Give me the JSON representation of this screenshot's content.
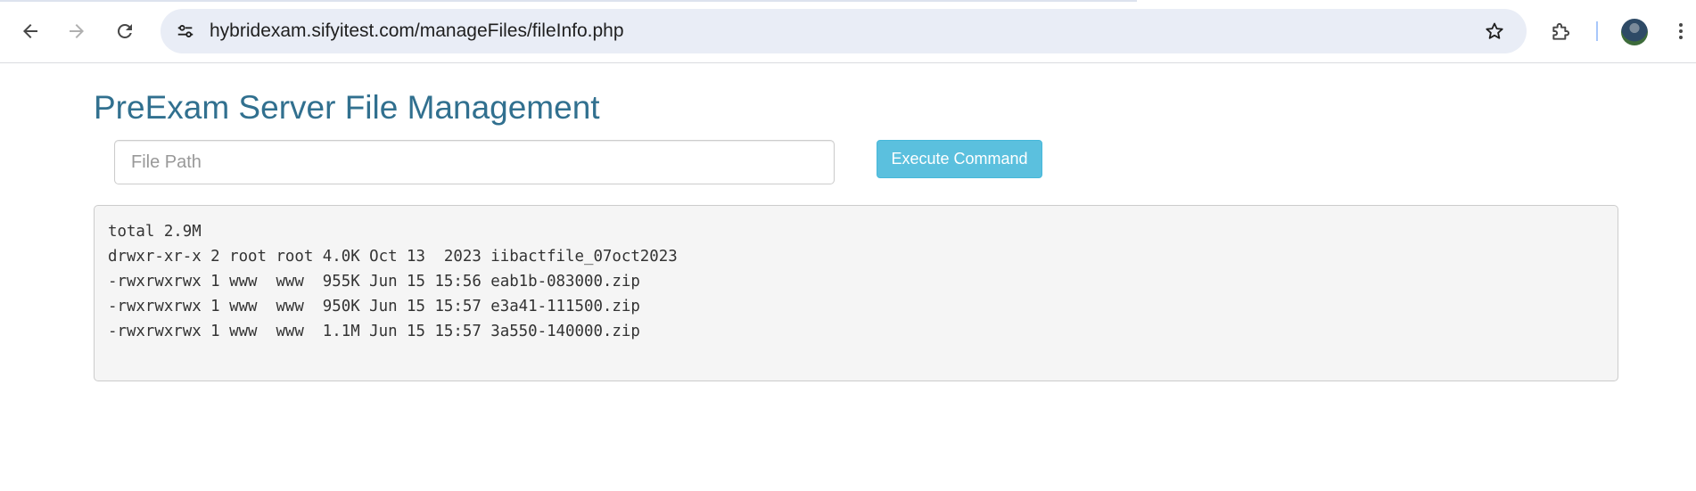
{
  "browser": {
    "url": "hybridexam.sifyitest.com/manageFiles/fileInfo.php"
  },
  "page": {
    "title": "PreExam Server File Management",
    "file_path_placeholder": "File Path",
    "file_path_value": "",
    "execute_button_label": "Execute Command",
    "output_lines": [
      "total 2.9M",
      "drwxr-xr-x 2 root root 4.0K Oct 13  2023 iibactfile_07oct2023",
      "-rwxrwxrwx 1 www  www  955K Jun 15 15:56 eab1b-083000.zip",
      "-rwxrwxrwx 1 www  www  950K Jun 15 15:57 e3a41-111500.zip",
      "-rwxrwxrwx 1 www  www  1.1M Jun 15 15:57 3a550-140000.zip"
    ]
  },
  "icons": {
    "back": "back-arrow-icon",
    "forward": "forward-arrow-icon",
    "reload": "reload-icon",
    "site_info": "tune-icon",
    "bookmark": "star-icon",
    "extensions": "puzzle-icon",
    "profile": "avatar",
    "menu": "kebab-menu-icon"
  },
  "colors": {
    "title": "#31708f",
    "button": "#5bc0de",
    "output_bg": "#f5f5f5",
    "omnibox": "#e9edf6"
  }
}
